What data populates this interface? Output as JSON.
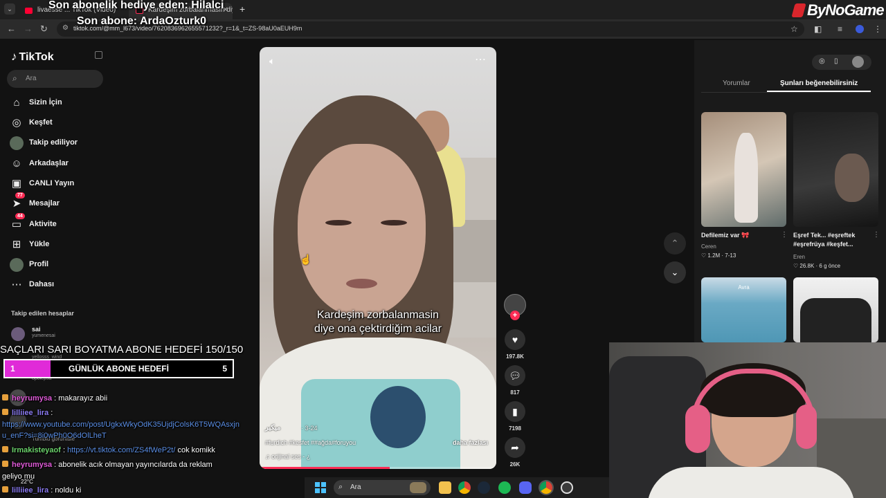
{
  "browser": {
    "tabs": [
      {
        "label": "livaesse ... TikTok (Video)",
        "active": false
      },
      {
        "label": "Kardeşim zorbalanmasın diye ...",
        "active": true
      }
    ],
    "new_tab": "+",
    "url": "tiktok.com/@mm_l673/video/7620836962655571232?_r=1&_t=ZS-98aU0aEUH9m"
  },
  "overlay": {
    "gift_text": "Son abonelik hediye eden: Hilalci",
    "sub_text": "Son abone: ArdaOzturk0",
    "channel_logo": "ByNoGame"
  },
  "tiktok": {
    "logo": "TikTok",
    "search_placeholder": "Ara",
    "menu": [
      {
        "label": "Sizin İçin",
        "icon": "home-icon",
        "glyph": "⌂"
      },
      {
        "label": "Keşfet",
        "icon": "compass-icon",
        "glyph": "◎"
      },
      {
        "label": "Takip ediliyor",
        "icon": "avatar-icon",
        "glyph": "●"
      },
      {
        "label": "Arkadaşlar",
        "icon": "friends-icon",
        "glyph": "☺"
      },
      {
        "label": "CANLI Yayın",
        "icon": "live-tv-icon",
        "glyph": "▣"
      },
      {
        "label": "Mesajlar",
        "icon": "paper-plane-icon",
        "glyph": "➤",
        "badge": "77"
      },
      {
        "label": "Aktivite",
        "icon": "inbox-icon",
        "glyph": "▭",
        "badge": "44"
      },
      {
        "label": "Yükle",
        "icon": "upload-icon",
        "glyph": "⊞"
      },
      {
        "label": "Profil",
        "icon": "profile-avatar-icon",
        "glyph": "●"
      },
      {
        "label": "Dahası",
        "icon": "more-dots-icon",
        "glyph": "⋯"
      }
    ],
    "followed_heading": "Takip edilen hesaplar",
    "followed": [
      {
        "name": "sai",
        "handle": "yumenesai"
      }
    ]
  },
  "video": {
    "caption_line1": "Kardeşim zorbalanmasin",
    "caption_line2": "diye ona çektirdiğim acilar",
    "author": "میکیر",
    "date": "· 3-24",
    "tags": "#furdich #kesfet ##ağda#foruyou",
    "more": "daha fazlası",
    "sound": "♫  orijinal ses - ¿",
    "progress": 0.55,
    "likes": "197.8K",
    "comments": "817",
    "saves": "7198",
    "shares": "26K"
  },
  "right_panel": {
    "tab_comments": "Yorumlar",
    "tab_suggestions": "Şunları beğenebilirsiniz",
    "cards": [
      {
        "title": "Defilemiz var 🎀",
        "author": "Ceren",
        "stats": "♡ 1.2M · 7-13",
        "color": "#8a7a6d"
      },
      {
        "title": "Eşref Tek... #eşreftek #eşrefrüya #keşfet...",
        "author": "Eren",
        "stats": "♡ 26.8K · 6 g önce",
        "color": "#2b2b2b"
      },
      {
        "title": "",
        "author": "",
        "stats": "",
        "label": "Avra",
        "color": "#6aa9c4"
      },
      {
        "title": "",
        "author": "",
        "stats": "",
        "color": "#d9d9d9"
      }
    ]
  },
  "stream": {
    "sub_goal_text": "SAÇLARI SARI BOYATMA ABONE HEDEFİ 150/150",
    "daily_goal": {
      "start": "1",
      "label": "GÜNLÜK ABONE HEDEFİ",
      "end": "5",
      "fraction": 0.2
    },
    "faded_names": [
      "yellosss_wind",
      "opolepsa",
      "Tumblu görüntüle"
    ],
    "chat": [
      {
        "user": "heyrumysa",
        "text": " : makarayız abii",
        "color": "#e05ad8"
      },
      {
        "user": "lilliiee_lira",
        "text": " :",
        "color": "#8a7af0"
      },
      {
        "user": "",
        "text": "https://www.youtube.com/post/UgkxWkyOdK35UjdjColsK6T5WQAsxjn",
        "link": true
      },
      {
        "user": "",
        "text": "u_enF?si=8i0wPh0O6dOlLheT",
        "link": true
      },
      {
        "user": "Irmakisteyaof",
        "text": " : ",
        "link_text": "https://vt.tiktok.com/ZS4fWeP2t/",
        "after": " cok komikk",
        "color": "#6bd36b"
      },
      {
        "user": "heyrumysa",
        "text": " : abonelik acık olmayan yayıncılarda da reklam",
        "color": "#e05ad8"
      },
      {
        "user": "",
        "text": "geliyo mu"
      },
      {
        "user": "lilliiee_lira",
        "text": " : noldu ki",
        "color": "#8a7af0"
      }
    ]
  },
  "taskbar": {
    "search_placeholder": "Ara",
    "weather": "22°C"
  }
}
